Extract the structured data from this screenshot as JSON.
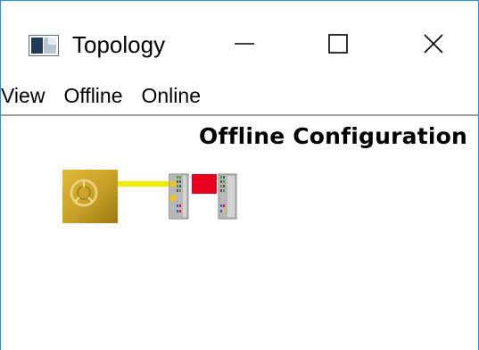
{
  "window": {
    "title": "Topology",
    "app_icon": "window-app-icon",
    "controls": {
      "minimize_icon": "minimize-icon",
      "maximize_icon": "maximize-icon",
      "close_icon": "close-icon"
    }
  },
  "menu": {
    "items": [
      {
        "label": "View"
      },
      {
        "label": "Offline"
      },
      {
        "label": "Online"
      }
    ]
  },
  "canvas": {
    "heading": "Offline Configuration",
    "nodes": [
      {
        "icon": "ethercat-master-icon"
      },
      {
        "icon": "io-coupler-terminal-icon"
      }
    ],
    "link_color": "#f0ec00",
    "colors": {
      "master_gold": "#c9a227",
      "terminal_red": "#e8001c",
      "terminal_gray": "#b8b8b8"
    }
  }
}
